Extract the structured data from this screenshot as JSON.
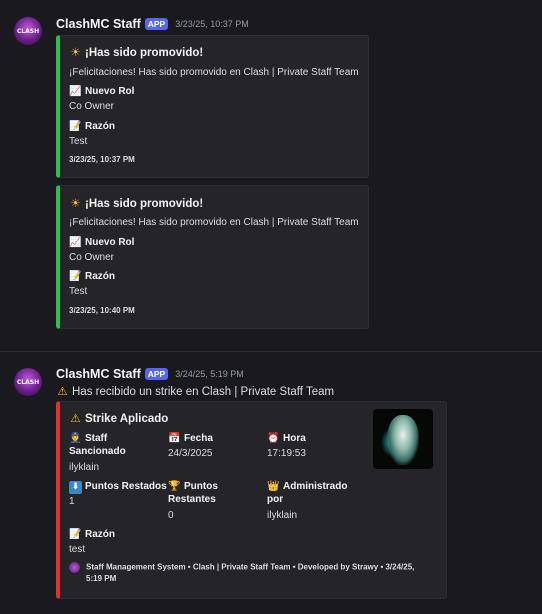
{
  "messages": [
    {
      "author": "ClashMC Staff",
      "badge": "APP",
      "timestamp": "3/23/25, 10:37 PM",
      "avatar_text": "CLASH",
      "embeds": [
        {
          "title": "Has sido promovido!",
          "title_emoji": "☀",
          "description": "¡Felicitaciones! Has sido promovido en Clash | Private Staff Team",
          "fields": [
            {
              "emoji": "📈",
              "name": "Nuevo Rol",
              "value": "Co Owner"
            },
            {
              "emoji": "📝",
              "name": "Razón",
              "value": "Test"
            }
          ],
          "footer": "3/23/25, 10:37 PM"
        },
        {
          "title": "Has sido promovido!",
          "title_emoji": "☀",
          "description": "¡Felicitaciones! Has sido promovido en Clash | Private Staff Team",
          "fields": [
            {
              "emoji": "📈",
              "name": "Nuevo Rol",
              "value": "Co Owner"
            },
            {
              "emoji": "📝",
              "name": "Razón",
              "value": "Test"
            }
          ],
          "footer": "3/23/25, 10:40 PM"
        }
      ]
    },
    {
      "author": "ClashMC Staff",
      "badge": "APP",
      "timestamp": "3/24/25, 5:19 PM",
      "avatar_text": "CLASH",
      "content_emoji": "⚠",
      "content": "Has recibido un strike en Clash | Private Staff Team",
      "embed": {
        "title_emoji": "⚠",
        "title": "Strike Aplicado",
        "fields": [
          {
            "emoji": "👮",
            "name_line1": "Staff",
            "name_line2": "Sancionado",
            "value": "ilyklain"
          },
          {
            "emoji": "📅",
            "name_line1": "Fecha",
            "name_line2": "",
            "value": "24/3/2025"
          },
          {
            "emoji": "⏰",
            "name_line1": "Hora",
            "name_line2": "",
            "value": "17:19:53"
          },
          {
            "emoji": "⬇",
            "name_line1": "Puntos Restados",
            "name_line2": "",
            "value": "1"
          },
          {
            "emoji": "🏆",
            "name_line1": "Puntos",
            "name_line2": "Restantes",
            "value": "0"
          },
          {
            "emoji": "👑",
            "name_line1": "Administrado",
            "name_line2": "por",
            "value": "ilyklain"
          },
          {
            "emoji": "📝",
            "name_line1": "Razón",
            "name_line2": "",
            "value": "test"
          }
        ],
        "footer_line1": "Staff Management System • Clash | Private Staff Team • Developed by Strawy • 3/24/25,",
        "footer_line2": "5:19 PM"
      }
    }
  ],
  "colors": {
    "background": "#1a1a1e",
    "embed_bg": "#242429",
    "promo_accent": "#23c552",
    "strike_accent": "#e62e2e",
    "badge": "#5865f2"
  }
}
